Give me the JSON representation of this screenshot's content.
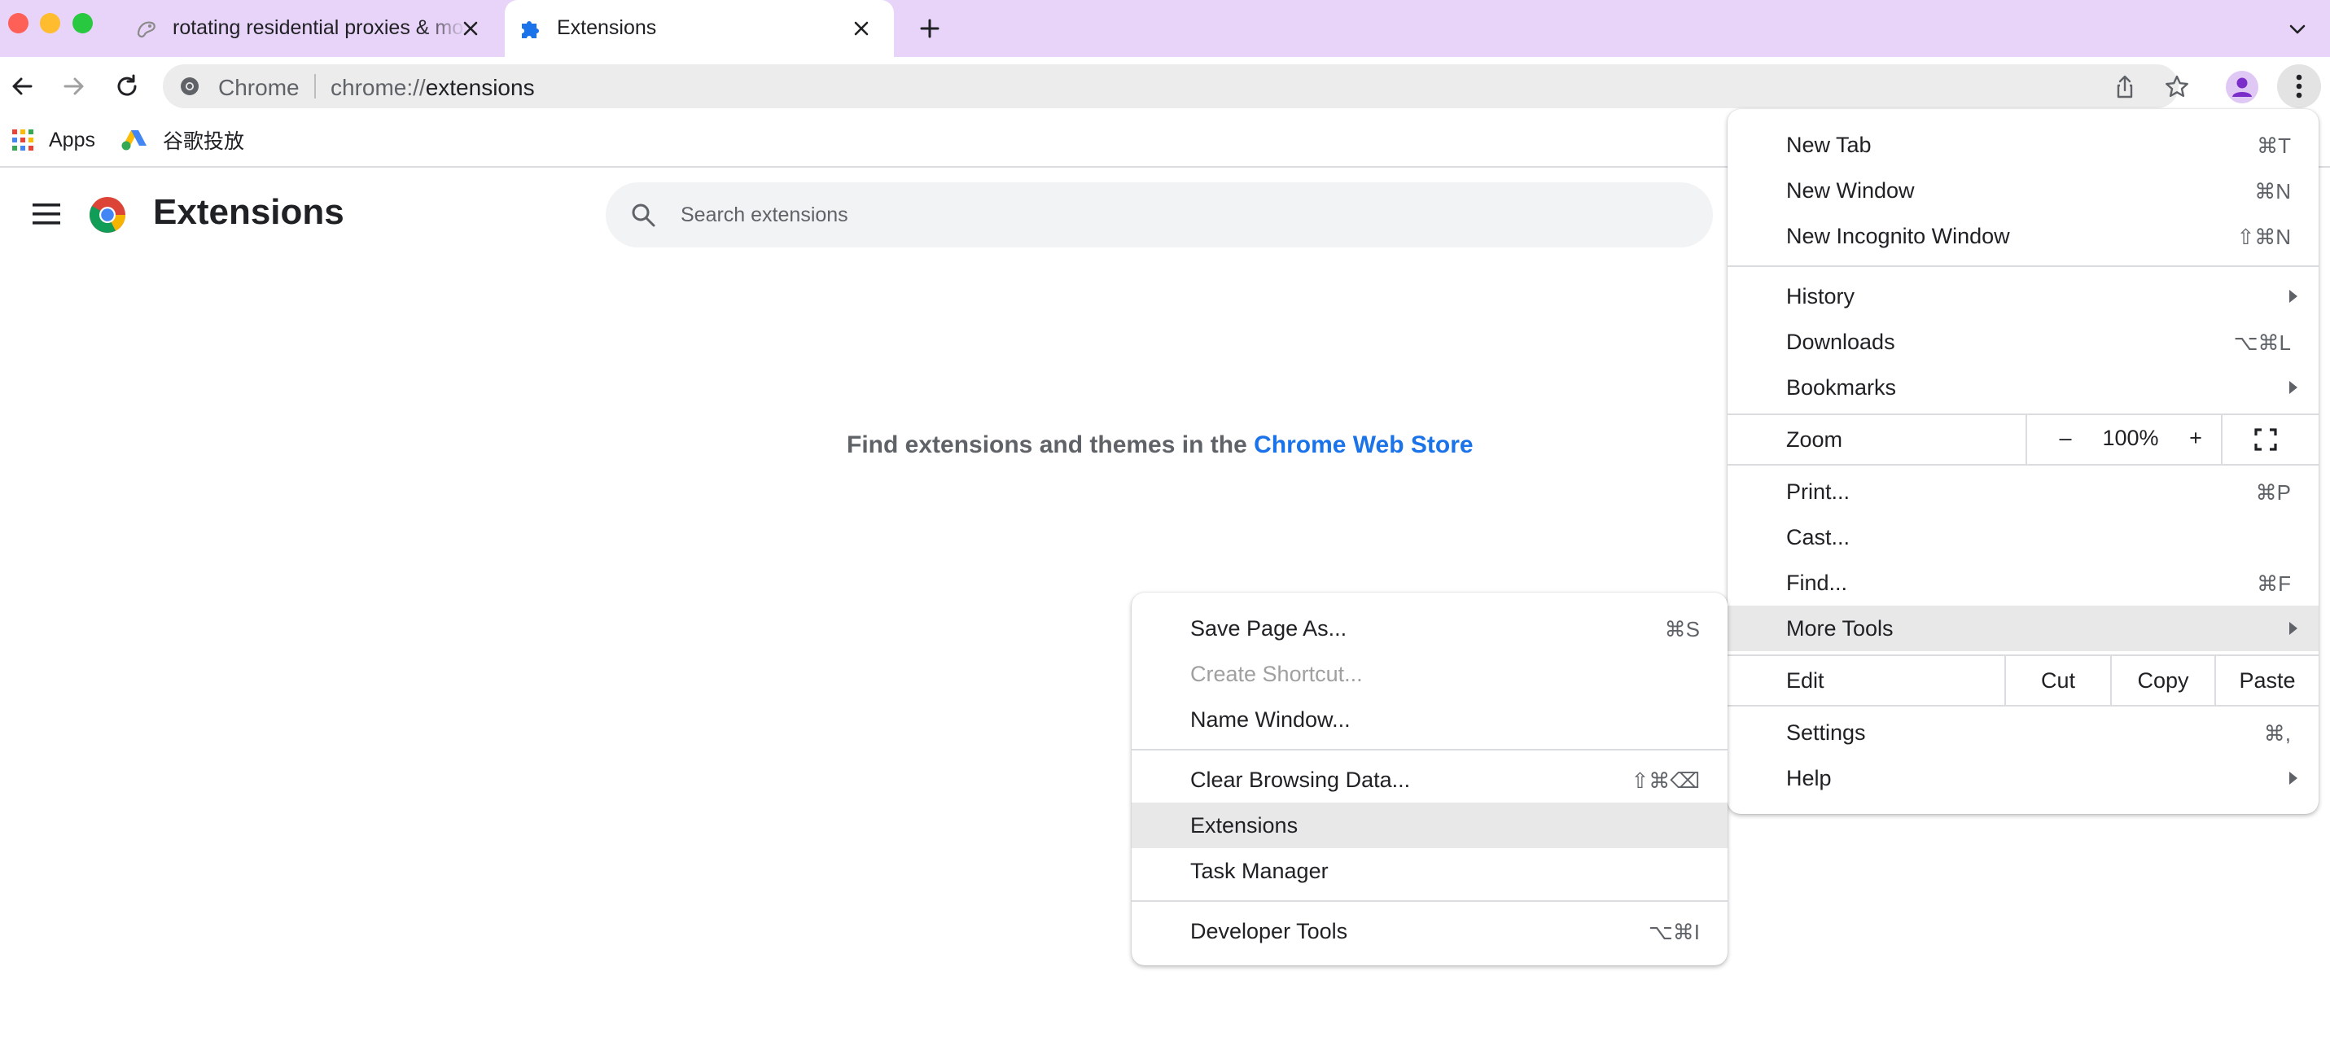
{
  "tabs": [
    {
      "title": "rotating residential proxies & mobile proxies",
      "icon": "lumi-favicon-icon"
    },
    {
      "title": "Extensions",
      "icon": "puzzle-icon"
    }
  ],
  "toolbar": {
    "chip": "Chrome",
    "url_scheme": "chrome://",
    "url_host": "extensions"
  },
  "bookmarks": [
    {
      "label": "Apps",
      "icon": "apps-grid-icon"
    },
    {
      "label": "谷歌投放",
      "icon": "google-ads-icon"
    }
  ],
  "page": {
    "title": "Extensions",
    "search_placeholder": "Search extensions",
    "empty_prefix": "Find extensions and themes in the ",
    "empty_link": "Chrome Web Store"
  },
  "main_menu": {
    "new_tab": {
      "label": "New Tab",
      "shortcut": "⌘T"
    },
    "new_window": {
      "label": "New Window",
      "shortcut": "⌘N"
    },
    "incognito": {
      "label": "New Incognito Window",
      "shortcut": "⇧⌘N"
    },
    "history": {
      "label": "History"
    },
    "downloads": {
      "label": "Downloads",
      "shortcut": "⌥⌘L"
    },
    "bookmarks": {
      "label": "Bookmarks"
    },
    "zoom": {
      "label": "Zoom",
      "minus": "–",
      "value": "100%",
      "plus": "+"
    },
    "print": {
      "label": "Print...",
      "shortcut": "⌘P"
    },
    "cast": {
      "label": "Cast..."
    },
    "find": {
      "label": "Find...",
      "shortcut": "⌘F"
    },
    "more_tools": {
      "label": "More Tools"
    },
    "edit": {
      "label": "Edit",
      "cut": "Cut",
      "copy": "Copy",
      "paste": "Paste"
    },
    "settings": {
      "label": "Settings",
      "shortcut": "⌘,"
    },
    "help": {
      "label": "Help"
    }
  },
  "sub_menu": {
    "save_page": {
      "label": "Save Page As...",
      "shortcut": "⌘S"
    },
    "create_shortcut": {
      "label": "Create Shortcut..."
    },
    "name_window": {
      "label": "Name Window..."
    },
    "clear_data": {
      "label": "Clear Browsing Data...",
      "shortcut": "⇧⌘⌫"
    },
    "extensions": {
      "label": "Extensions"
    },
    "task_manager": {
      "label": "Task Manager"
    },
    "dev_tools": {
      "label": "Developer Tools",
      "shortcut": "⌥⌘I"
    }
  },
  "colors": {
    "tabstrip": "#e8d4f8",
    "link": "#1a73e8",
    "highlight": "#e8e8e8"
  }
}
